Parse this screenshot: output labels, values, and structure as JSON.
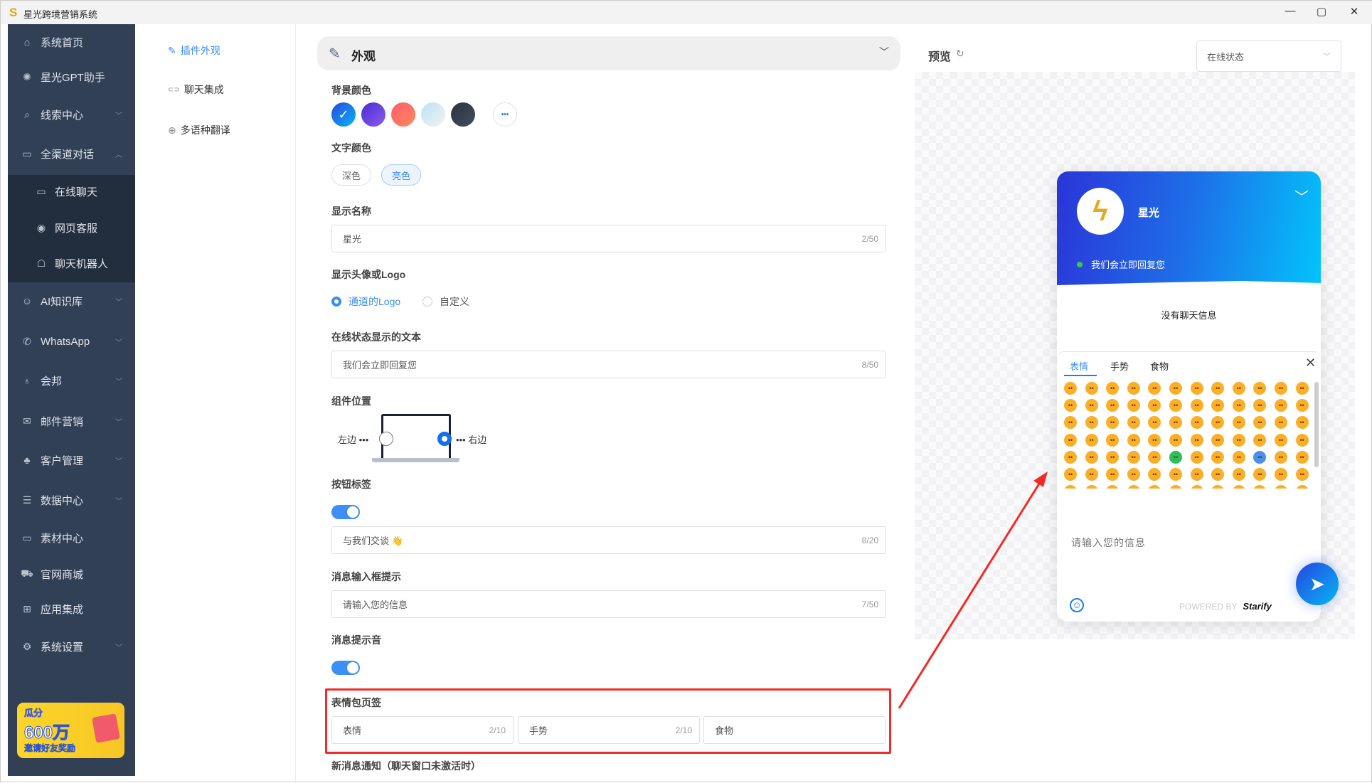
{
  "window": {
    "title": "星光跨境营销系统",
    "logo": "S",
    "controls": [
      "—",
      "▢",
      "✕"
    ]
  },
  "sidebar": {
    "items": [
      {
        "label": "系统首页",
        "icon": "⌂",
        "name": "home-icon",
        "chev": ""
      },
      {
        "label": "星光GPT助手",
        "icon": "✺",
        "name": "gpt-icon",
        "chev": ""
      },
      {
        "label": "线索中心",
        "icon": "⌕",
        "name": "search-box-icon",
        "chev": "﹀"
      },
      {
        "label": "全渠道对话",
        "icon": "▭",
        "name": "chat-icon",
        "chev": "︿"
      },
      {
        "label": "在线聊天",
        "icon": "▭",
        "name": "chat-bubbles-icon",
        "chev": "",
        "sub": true
      },
      {
        "label": "网页客服",
        "icon": "◉",
        "name": "support-icon",
        "chev": "",
        "sub": true
      },
      {
        "label": "聊天机器人",
        "icon": "☖",
        "name": "robot-icon",
        "chev": "",
        "sub": true
      },
      {
        "label": "AI知识库",
        "icon": "☺",
        "name": "brain-icon",
        "chev": "﹀"
      },
      {
        "label": "WhatsApp",
        "icon": "✆",
        "name": "whatsapp-icon",
        "chev": "﹀"
      },
      {
        "label": "会邦",
        "icon": "♁",
        "name": "bulb-icon",
        "chev": "﹀"
      },
      {
        "label": "邮件营销",
        "icon": "✉",
        "name": "mail-icon",
        "chev": "﹀"
      },
      {
        "label": "客户管理",
        "icon": "♣",
        "name": "customers-icon",
        "chev": "﹀"
      },
      {
        "label": "数据中心",
        "icon": "☰",
        "name": "database-icon",
        "chev": "﹀"
      },
      {
        "label": "素材中心",
        "icon": "▭",
        "name": "folder-icon",
        "chev": ""
      },
      {
        "label": "官网商城",
        "icon": "⛟",
        "name": "cart-icon",
        "chev": ""
      },
      {
        "label": "应用集成",
        "icon": "⊞",
        "name": "apps-icon",
        "chev": ""
      },
      {
        "label": "系统设置",
        "icon": "⚙",
        "name": "gear-icon",
        "chev": "﹀"
      }
    ],
    "banner": {
      "line1": "瓜分",
      "line2": "600万",
      "line3": "邀请好友奖励"
    }
  },
  "subnav": [
    {
      "label": "插件外观",
      "icon": "✎"
    },
    {
      "label": "聊天集成",
      "icon": "⊂⊃"
    },
    {
      "label": "多语种翻译",
      "icon": "⊕"
    }
  ],
  "section": {
    "title": "外观",
    "icon": "✎",
    "chev": "﹀"
  },
  "form": {
    "bg_color": {
      "label": "背景颜色",
      "colors": [
        "#1a6cf0",
        "#6a3fe0",
        "#ff6f61",
        "#cfe8f5",
        "#2f3a48"
      ],
      "selected": 0,
      "more": "•••"
    },
    "text_color": {
      "label": "文字颜色",
      "options": [
        "深色",
        "亮色"
      ],
      "selected": 1
    },
    "display_name": {
      "label": "显示名称",
      "value": "星光",
      "count": "2/50"
    },
    "avatar": {
      "label": "显示头像或Logo",
      "options": [
        "通道的Logo",
        "自定义"
      ],
      "selected": 0
    },
    "status_text": {
      "label": "在线状态显示的文本",
      "value": "我们会立即回复您",
      "count": "8/50"
    },
    "position": {
      "label": "组件位置",
      "left": "左边 •••",
      "right": "••• 右边",
      "selected": "right"
    },
    "button_label": {
      "label": "按钮标签",
      "enabled": true,
      "value": "与我们交谈 👋",
      "count": "8/20"
    },
    "input_hint": {
      "label": "消息输入框提示",
      "value": "请输入您的信息",
      "count": "7/50"
    },
    "sound": {
      "label": "消息提示音",
      "enabled": true
    },
    "emoji_tabs": {
      "label": "表情包页签",
      "tabs": [
        {
          "value": "表情",
          "count": "2/10"
        },
        {
          "value": "手势",
          "count": "2/10"
        },
        {
          "value": "食物",
          "count": ""
        }
      ]
    },
    "new_msg": {
      "label": "新消息通知（聊天窗口未激活时）"
    }
  },
  "preview": {
    "title": "预览",
    "refresh_icon": "↻",
    "select": {
      "value": "在线状态",
      "chev": "﹀"
    },
    "widget": {
      "avatar": "ϟ",
      "name": "星光",
      "chev": "﹀",
      "status": "我们会立即回复您",
      "no_messages": "没有聊天信息",
      "emoji_tabs": [
        "表情",
        "手势",
        "食物"
      ],
      "close": "✕",
      "input_placeholder": "请输入您的信息",
      "emoji_button": "☺",
      "powered_by": "POWERED BY",
      "brand": "Starify",
      "send": "➤",
      "emojis": [
        "😀",
        "😃",
        "😄",
        "😁",
        "😆",
        "😅",
        "🤣",
        "😂",
        "🙂",
        "🙃",
        "😉",
        "😊",
        "😇",
        "🥰",
        "😍",
        "🤩",
        "😘",
        "😗",
        "😚",
        "😙",
        "🥲",
        "😋",
        "😛",
        "😜",
        "🤪",
        "😝",
        "🤑",
        "🤗",
        "🤭",
        "🫢",
        "🫣",
        "🤫",
        "🤔",
        "🫡",
        "🤐",
        "🤨",
        "😐",
        "😑",
        "😶",
        "🫥",
        "😏",
        "😒",
        "🙄",
        "😬",
        "🤥",
        "😌",
        "😔",
        "😪",
        "🤤",
        "😴",
        "😷",
        "🤒",
        "🤕",
        "🤢",
        "🤮",
        "🤧",
        "🥵",
        "🥶",
        "🥴",
        "😵",
        "🤯",
        "🤠",
        "🥳",
        "🥸",
        "😎",
        "🤓",
        "🧐",
        "😕",
        "🫤",
        "😟",
        "🙁",
        "😮",
        "😯",
        "😲",
        "😳",
        "🥺",
        "🥹",
        "😦",
        "😧",
        "😨",
        "😰",
        "😥",
        "😢",
        "😭",
        "😱",
        "😖",
        "😣",
        "😞",
        "😓",
        "😩",
        "😫",
        "🥱",
        "😤",
        "😡",
        "😠",
        "🤬",
        "😈",
        "👿",
        "💀",
        "☠",
        "🤡",
        "👹"
      ]
    }
  },
  "colors": {
    "accent": "#3a8ef6",
    "sidebar": "#324056",
    "highlight": "#f42a26"
  }
}
